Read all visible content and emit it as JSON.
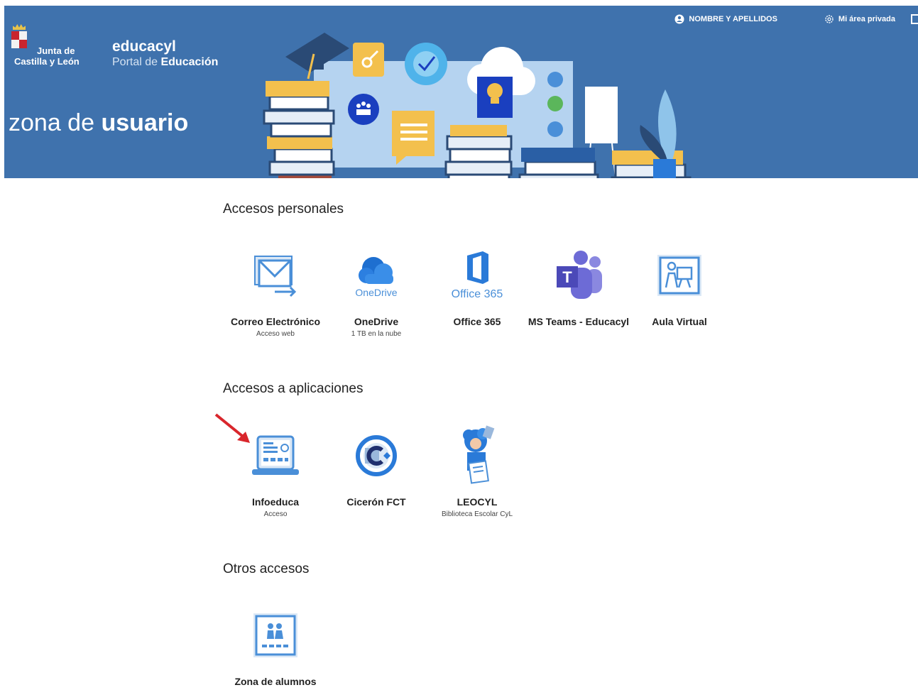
{
  "header": {
    "org_line1": "Junta de",
    "org_line2": "Castilla y León",
    "portal_name": "educacyl",
    "portal_sub_prefix": "Portal de ",
    "portal_sub_bold": "Educación",
    "zone_prefix": "zona de ",
    "zone_bold": "usuario",
    "user_link": "NOMBRE Y APELLIDOS",
    "private_link": "Mi área privada"
  },
  "sections": [
    {
      "title": "Accesos personales",
      "items": [
        {
          "label": "Correo Electrónico",
          "sub": "Acceso web",
          "icon": "mail-icon"
        },
        {
          "label": "OneDrive",
          "sub": "1 TB en la nube",
          "icon": "onedrive-icon",
          "caption": "OneDrive"
        },
        {
          "label": "Office 365",
          "sub": "",
          "icon": "office365-icon",
          "caption": "Office 365"
        },
        {
          "label": "MS Teams - Educacyl",
          "sub": "",
          "icon": "teams-icon"
        },
        {
          "label": "Aula Virtual",
          "sub": "",
          "icon": "aula-virtual-icon"
        }
      ]
    },
    {
      "title": "Accesos a aplicaciones",
      "items": [
        {
          "label": "Infoeduca",
          "sub": "Acceso",
          "icon": "infoeduca-icon"
        },
        {
          "label": "Cicerón FCT",
          "sub": "",
          "icon": "ciceron-icon"
        },
        {
          "label": "LEOCYL",
          "sub": "Biblioteca Escolar CyL",
          "icon": "leocyl-icon"
        }
      ]
    },
    {
      "title": "Otros accesos",
      "items": [
        {
          "label": "Zona de alumnos",
          "sub": "",
          "icon": "students-icon"
        }
      ]
    }
  ],
  "colors": {
    "banner": "#3f72ad",
    "accent_blue": "#4a8fd8",
    "arrow_red": "#d9262c"
  }
}
